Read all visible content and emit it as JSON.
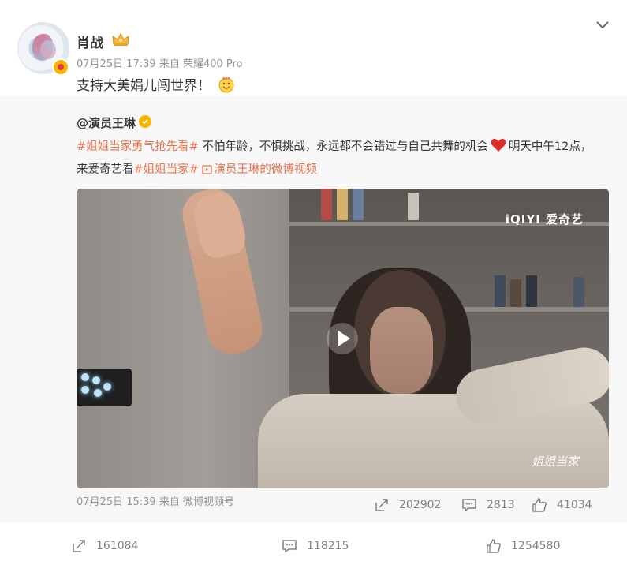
{
  "post": {
    "username": "肖战",
    "meta": "07月25日 17:39  来自 荣耀400 Pro",
    "text": "支持大美娟儿闯世界！"
  },
  "repost": {
    "username": "@演员王琳",
    "text_tag1": "#姐姐当家勇气抢先看#",
    "text_part1": " 不怕年龄，不惧挑战，永远都不会错过与自己共舞的机会",
    "text_part2": "明天中午12点，来爱奇艺看",
    "text_tag2": "#姐姐当家#",
    "video_link": "演员王琳的微博视频",
    "video_logo": "iQIYI 爱奇艺",
    "video_watermark": "姐姐当家",
    "meta": "07月25日 15:39  来自  微博视频号",
    "reposts": "202902",
    "comments": "2813",
    "likes": "41034"
  },
  "footer": {
    "reposts": "161084",
    "comments": "118215",
    "likes": "1254580"
  },
  "colors": {
    "tag": "#eb7350",
    "meta": "#939393",
    "verified": "#f7b500"
  }
}
